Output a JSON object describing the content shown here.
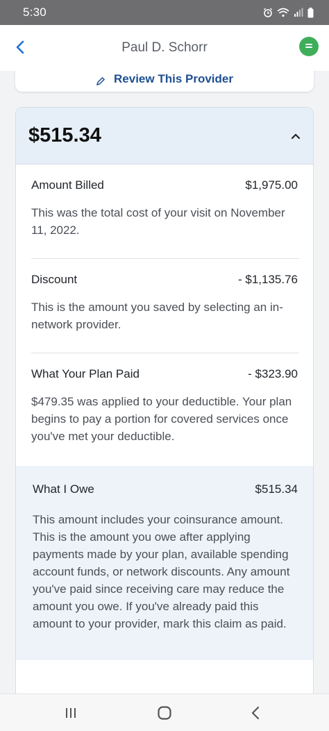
{
  "status_bar": {
    "time": "5:30"
  },
  "header": {
    "title": "Paul D. Schorr"
  },
  "review": {
    "label": "Review This Provider"
  },
  "claim": {
    "total": "$515.34",
    "sections": [
      {
        "label": "Amount Billed",
        "value": "$1,975.00",
        "description": "This was the total cost of your visit on November 11, 2022."
      },
      {
        "label": "Discount",
        "value": "- $1,135.76",
        "description": "This is the amount you saved by selecting an in-network provider."
      },
      {
        "label": "What Your Plan Paid",
        "value": "- $323.90",
        "description": "$479.35 was applied to your deductible. Your plan begins to pay a portion for covered services once you've met your deductible."
      }
    ],
    "owe": {
      "label": "What I Owe",
      "value": "$515.34",
      "description": "This amount includes your coinsurance amount. This is the amount you owe after applying payments made by your plan, available spending account funds, or network discounts. Any amount you've paid since receiving care may reduce the amount you owe. If you've already paid this amount to your provider, mark this claim as paid."
    }
  },
  "colors": {
    "accent_blue": "#1e4f91",
    "chat_green": "#3fae5a",
    "header_band": "#e6eef8"
  },
  "icons": [
    "alarm-icon",
    "wifi-icon",
    "signal-icon",
    "battery-icon",
    "back-arrow-icon",
    "chat-icon",
    "pencil-icon",
    "chevron-up-icon",
    "recent-apps-icon",
    "home-icon",
    "nav-back-icon"
  ]
}
